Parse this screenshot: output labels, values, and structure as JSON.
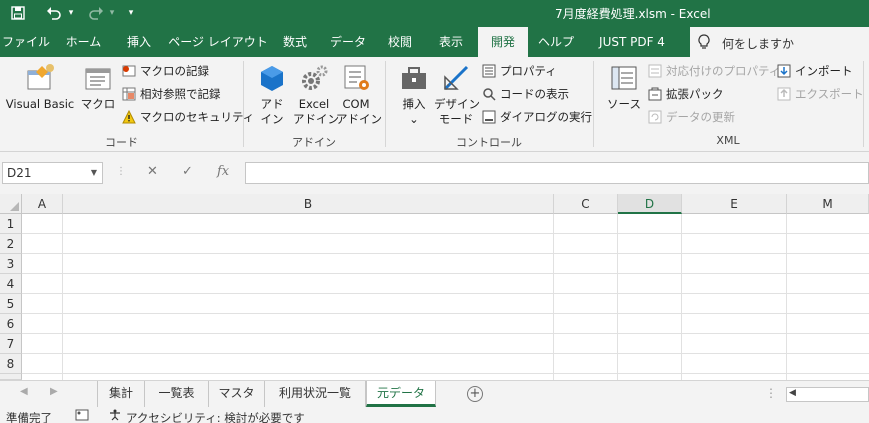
{
  "titlebar": {
    "title": "7月度経費処理.xlsm  -  Excel",
    "bg_color": "#217346"
  },
  "ribbon_tabs": [
    {
      "label": "ファイル"
    },
    {
      "label": "ホーム"
    },
    {
      "label": "挿入"
    },
    {
      "label": "ページ レイアウト"
    },
    {
      "label": "数式"
    },
    {
      "label": "データ"
    },
    {
      "label": "校閲"
    },
    {
      "label": "表示"
    },
    {
      "label": "開発",
      "active": true
    },
    {
      "label": "ヘルプ"
    },
    {
      "label": "JUST PDF 4"
    }
  ],
  "tell_me": "何をしますか",
  "groups": {
    "code": {
      "label": "コード",
      "visual_basic": "Visual Basic",
      "macro": "マクロ",
      "record_macro": "マクロの記録",
      "relative_ref": "相対参照で記録",
      "macro_security": "マクロのセキュリティ"
    },
    "addins": {
      "label": "アドイン",
      "addin_1": "アド",
      "addin_2": "イン",
      "excel_addin_1": "Excel",
      "excel_addin_2": "アドイン",
      "com_addin_1": "COM",
      "com_addin_2": "アドイン"
    },
    "controls": {
      "label": "コントロール",
      "insert": "挿入",
      "insert_arrow": "⌄",
      "design_mode_1": "デザイン",
      "design_mode_2": "モード",
      "properties": "プロパティ",
      "view_code": "コードの表示",
      "run_dialog": "ダイアログの実行"
    },
    "xml": {
      "label": "XML",
      "source": "ソース",
      "map_properties": "対応付けのプロパティ",
      "expansion_packs": "拡張パック",
      "refresh_data": "データの更新",
      "import": "インポート",
      "export": "エクスポート"
    }
  },
  "formula_bar": {
    "name_box": "D21",
    "cancel": "✕",
    "enter": "✓",
    "fx": "fx",
    "value": ""
  },
  "columns": [
    "A",
    "B",
    "C",
    "D",
    "E",
    "M"
  ],
  "selected_column": "D",
  "rows": [
    "1",
    "2",
    "3",
    "4",
    "5",
    "6",
    "7",
    "8"
  ],
  "sheets": [
    {
      "label": "集計"
    },
    {
      "label": "一覧表"
    },
    {
      "label": "マスタ"
    },
    {
      "label": "利用状況一覧"
    },
    {
      "label": "元データ",
      "active": true
    }
  ],
  "add_sheet": "+",
  "status": {
    "ready": "準備完了",
    "accessibility": "アクセシビリティ: 検討が必要です"
  }
}
